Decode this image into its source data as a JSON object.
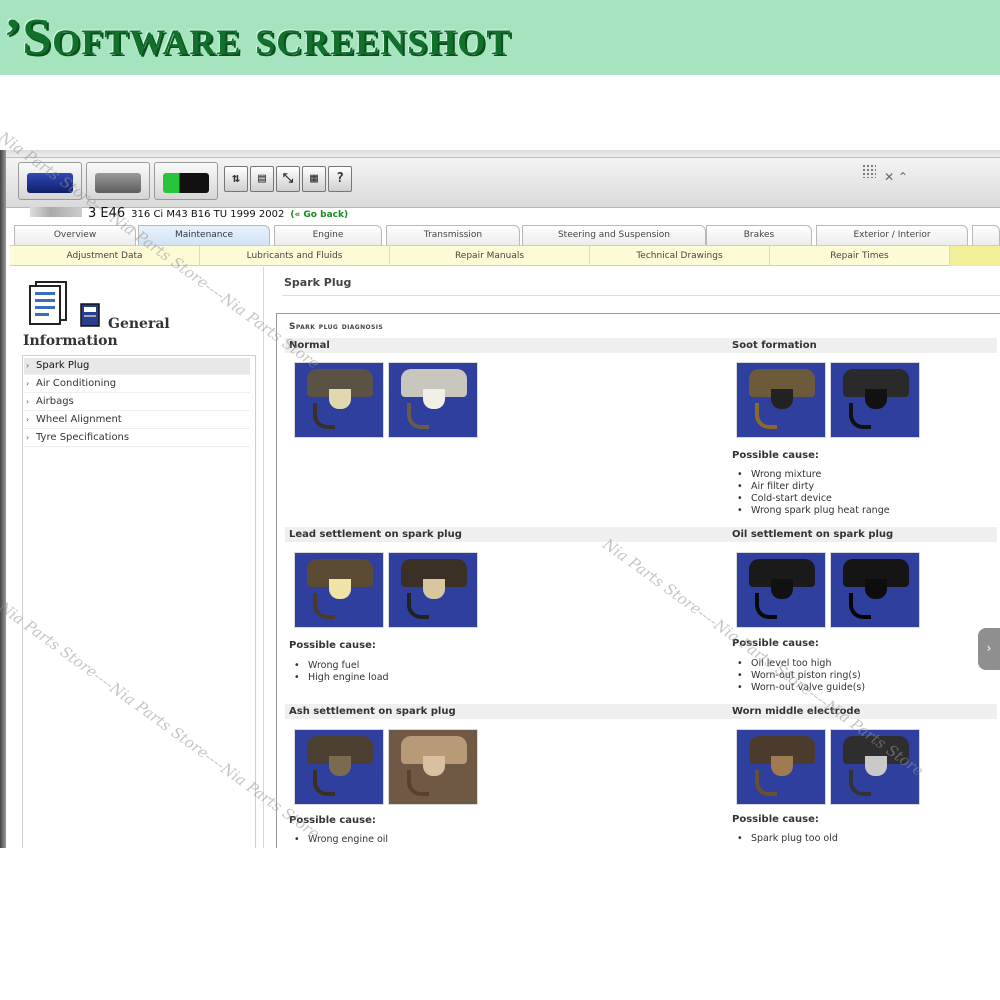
{
  "banner": {
    "title": "’Software screenshot"
  },
  "toolbar": {
    "buttons": [
      {
        "icon": "car-icon"
      },
      {
        "icon": "document-icon"
      },
      {
        "icon": "battery-icon"
      }
    ],
    "small_buttons": [
      {
        "glyph": "⇅",
        "icon": "filter-icon"
      },
      {
        "glyph": "▤",
        "icon": "copy-icon"
      },
      {
        "glyph": "⤡",
        "icon": "resize-icon"
      },
      {
        "glyph": "▦",
        "icon": "calculator-icon"
      },
      {
        "glyph": "?",
        "icon": "help-icon"
      }
    ],
    "right_glyphs": "✕ ⌃"
  },
  "vehicle": {
    "model": "3 E46",
    "spec": "316 Ci M43 B16 TU 1999 2002",
    "go_back": "(« Go back)"
  },
  "tabs": [
    "Overview",
    "Maintenance",
    "Engine",
    "Transmission",
    "Steering and Suspension",
    "Brakes",
    "Exterior / Interior"
  ],
  "active_tab": "Maintenance",
  "subnav": [
    "Adjustment Data",
    "Lubricants and Fluids",
    "Repair Manuals",
    "Technical Drawings",
    "Repair Times"
  ],
  "sidebar": {
    "title_line1": "General",
    "title_line2": "Information",
    "items": [
      "Spark Plug",
      "Air Conditioning",
      "Airbags",
      "Wheel Alignment",
      "Tyre Specifications"
    ],
    "active": "Spark Plug"
  },
  "main": {
    "title": "Spark Plug",
    "diagnosis_title": "Spark plug diagnosis",
    "possible_cause_label": "Possible cause:",
    "sections": [
      {
        "title": "Normal",
        "causes": []
      },
      {
        "title": "Soot formation",
        "causes": [
          "Wrong mixture",
          "Air filter dirty",
          "Cold-start device",
          "Wrong spark plug heat range"
        ]
      },
      {
        "title": "Lead settlement on spark plug",
        "causes": [
          "Wrong fuel",
          "High engine load"
        ]
      },
      {
        "title": "Oil settlement on spark plug",
        "causes": [
          "Oil level too high",
          "Worn-out piston ring(s)",
          "Worn-out valve guide(s)"
        ]
      },
      {
        "title": "Ash settlement on spark plug",
        "causes": [
          "Wrong engine oil"
        ]
      },
      {
        "title": "Worn middle electrode",
        "causes": [
          "Spark plug too old"
        ]
      }
    ]
  },
  "watermark": "Nia Parts Store----Nia Parts Store----Nia Parts Store",
  "colors": {
    "banner_bg": "#a6e4c0",
    "banner_text": "#11702c",
    "photo_bg": "#2e3f9e",
    "subnav_bg": "#fdfbd5",
    "go_back": "#178a1f"
  }
}
